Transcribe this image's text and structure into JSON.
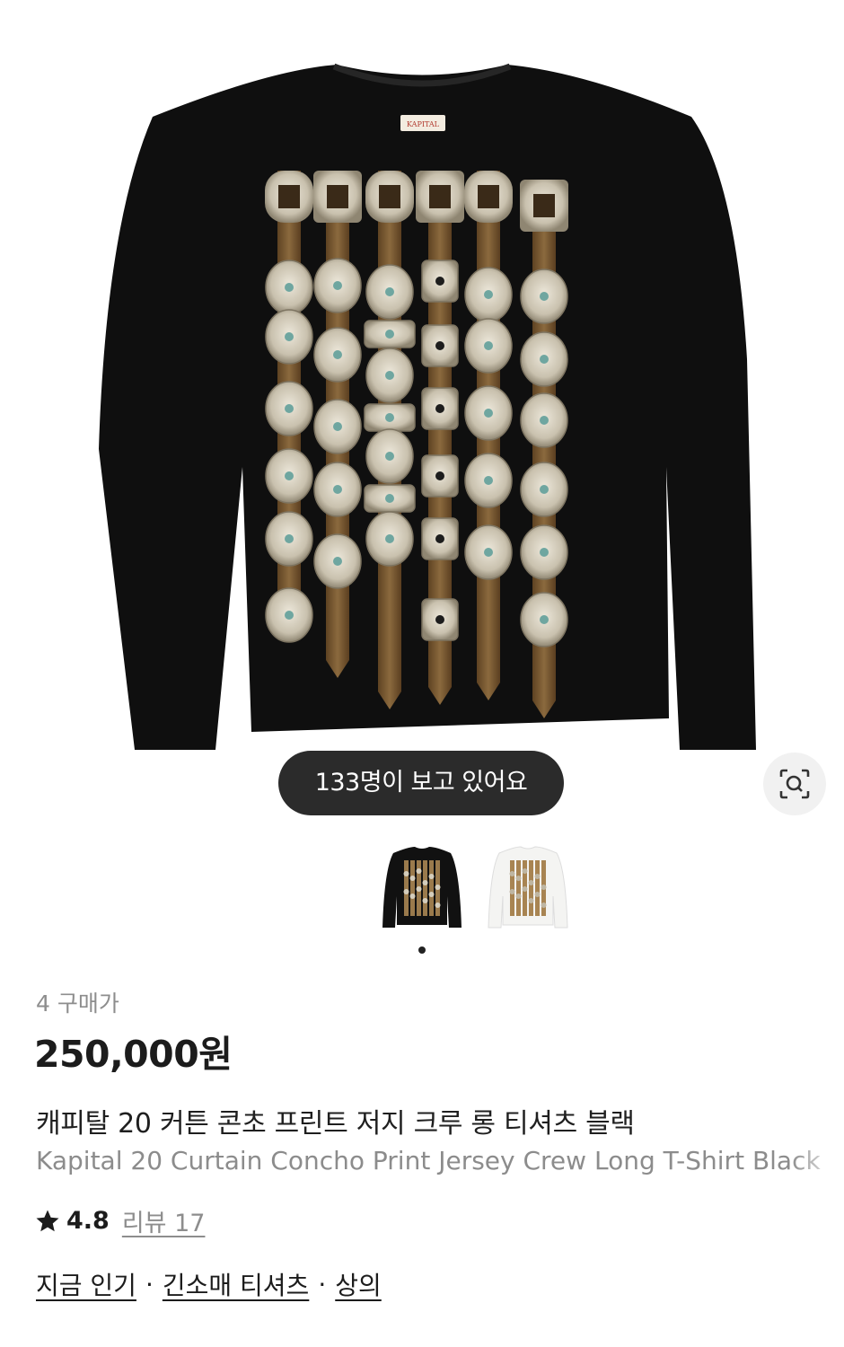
{
  "viewer_badge": "133명이 보고 있어요",
  "lens_icon": "camera-search-icon",
  "shirt_label_text": "KAPITAL",
  "thumbnails": [
    {
      "name": "black",
      "selected": true
    },
    {
      "name": "white",
      "selected": false
    }
  ],
  "product": {
    "buyers": "4 구매가",
    "price": "250,000원",
    "name_ko": "캐피탈 20 커튼 콘초 프린트 저지 크루 롱 티셔츠 블랙",
    "name_en": "Kapital 20 Curtain Concho Print Jersey Crew Long T-Shirt Black",
    "rating": "4.8",
    "reviews": "리뷰 17"
  },
  "categories": [
    {
      "label": "지금 인기"
    },
    {
      "label": "긴소매 티셔츠"
    },
    {
      "label": "상의"
    }
  ],
  "colors": {
    "shirt_black": "#0f0f0f",
    "leather": "#7a5a34",
    "silver": "#cfc8b8",
    "badge_bg": "#2b2b2b"
  }
}
